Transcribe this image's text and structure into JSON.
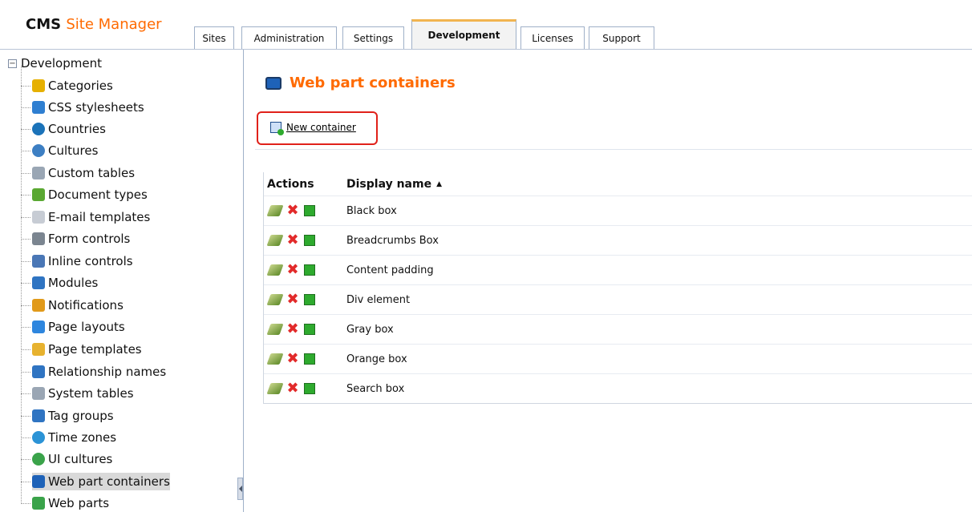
{
  "app": {
    "logo_main": "CMS",
    "logo_accent": "Site Manager"
  },
  "tabs": [
    {
      "label": "Sites",
      "active": false
    },
    {
      "label": "Administration",
      "active": false
    },
    {
      "label": "Settings",
      "active": false
    },
    {
      "label": "Development",
      "active": true
    },
    {
      "label": "Licenses",
      "active": false
    },
    {
      "label": "Support",
      "active": false
    }
  ],
  "sidebar": {
    "root_label": "Development",
    "items": [
      {
        "label": "Categories",
        "icon": "categories-icon",
        "color": "#e6b000"
      },
      {
        "label": "CSS stylesheets",
        "icon": "css-icon",
        "color": "#2f7fd1"
      },
      {
        "label": "Countries",
        "icon": "globe-icon",
        "color": "#1b73b9"
      },
      {
        "label": "Cultures",
        "icon": "culture-globe-icon",
        "color": "#3d7fc3"
      },
      {
        "label": "Custom tables",
        "icon": "table-icon",
        "color": "#9aa6b4"
      },
      {
        "label": "Document types",
        "icon": "document-types-icon",
        "color": "#5aa832"
      },
      {
        "label": "E-mail templates",
        "icon": "email-icon",
        "color": "#c7ccd4"
      },
      {
        "label": "Form controls",
        "icon": "form-controls-icon",
        "color": "#7b8590"
      },
      {
        "label": "Inline controls",
        "icon": "inline-controls-icon",
        "color": "#4a77b6"
      },
      {
        "label": "Modules",
        "icon": "modules-icon",
        "color": "#2f74c2"
      },
      {
        "label": "Notifications",
        "icon": "notifications-icon",
        "color": "#e19a1a"
      },
      {
        "label": "Page layouts",
        "icon": "page-layouts-icon",
        "color": "#2e86de"
      },
      {
        "label": "Page templates",
        "icon": "page-templates-icon",
        "color": "#e7b22f"
      },
      {
        "label": "Relationship names",
        "icon": "relationship-icon",
        "color": "#2f74c2"
      },
      {
        "label": "System tables",
        "icon": "system-tables-icon",
        "color": "#9aa6b4"
      },
      {
        "label": "Tag groups",
        "icon": "tag-groups-icon",
        "color": "#2f74c2"
      },
      {
        "label": "Time zones",
        "icon": "time-zones-icon",
        "color": "#2b93d6"
      },
      {
        "label": "UI cultures",
        "icon": "ui-cultures-icon",
        "color": "#3aa34a"
      },
      {
        "label": "Web part containers",
        "icon": "web-part-containers-icon",
        "color": "#1e62b8",
        "selected": true
      },
      {
        "label": "Web parts",
        "icon": "web-parts-icon",
        "color": "#3aa34a"
      }
    ]
  },
  "main": {
    "title": "Web part containers",
    "new_container_label": "New container",
    "grid": {
      "header_actions": "Actions",
      "header_name": "Display name",
      "sort_indicator": "▲",
      "rows": [
        "Black box",
        "Breadcrumbs Box",
        "Content padding",
        "Div element",
        "Gray box",
        "Orange box",
        "Search box"
      ]
    }
  },
  "colors": {
    "accent": "#ff6a00",
    "highlight_border": "#e0211a",
    "active_tab": "#f1b450",
    "border": "#9fb0c8"
  }
}
